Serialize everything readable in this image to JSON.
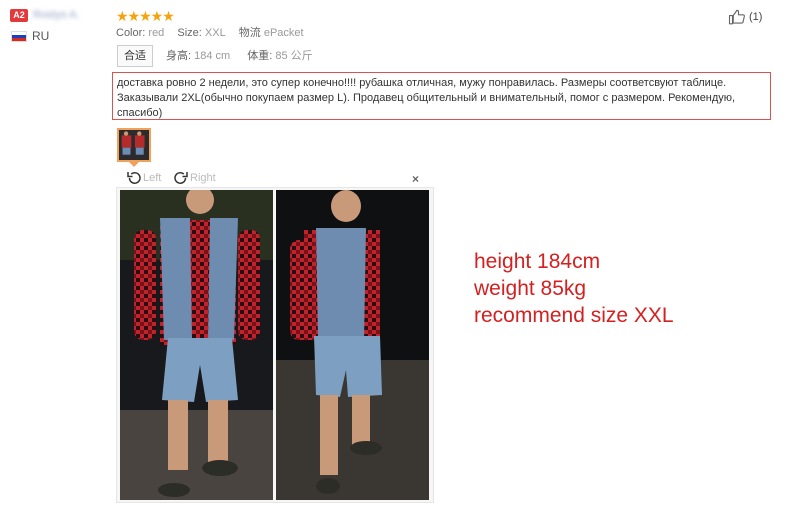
{
  "user": {
    "badge": "A2",
    "name": "Rostys A.",
    "country": "RU"
  },
  "review": {
    "stars": "★★★★★",
    "color_label": "Color:",
    "color_value": "red",
    "size_label": "Size:",
    "size_value": "XXL",
    "logistics_label": "物流",
    "logistics_value": "ePacket",
    "fit_tag": "合适",
    "height_label": "身高:",
    "height_value": "184 cm",
    "weight_label": "体重:",
    "weight_value": "85 公斤",
    "likes": "(1)",
    "text": "доставка ровно 2 недели, это супер конечно!!!! рубашка отличная, мужу понравилась. Размеры соответсвуют таблице. Заказывали 2XL(обычно покупаем размер L). Продавец общительный и внимательный, помог с размером. Рекомендую, спасибо)"
  },
  "viewer": {
    "rotate_left": "Left",
    "rotate_right": "Right",
    "close": "×"
  },
  "annotation": {
    "line1": "height 184cm",
    "line2": "weight 85kg",
    "line3": "recommend size XXL"
  },
  "colors": {
    "star": "#f7a20a",
    "annotation": "#d42020",
    "highlight_border": "#d9534f",
    "thumb_border": "#f0a25a"
  }
}
